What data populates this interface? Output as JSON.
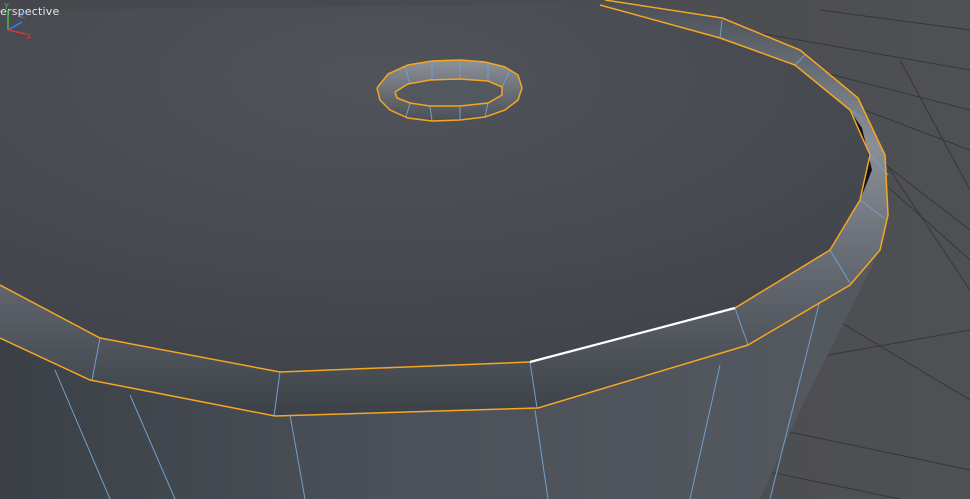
{
  "viewport": {
    "view_label": "erspective"
  },
  "axis": {
    "y_label": "Y",
    "z_label": "Z",
    "x_label": "X",
    "y_color": "#3ec13e",
    "z_color": "#3a7cff",
    "x_color": "#e03434"
  },
  "colors": {
    "background": "#4a4b4f",
    "grid_line": "#2e2f33",
    "mesh_surface": "#4b4e54",
    "edge_selected": "#f5a623",
    "edge_active": "#ffffff",
    "wire": "#7aa3c9"
  }
}
